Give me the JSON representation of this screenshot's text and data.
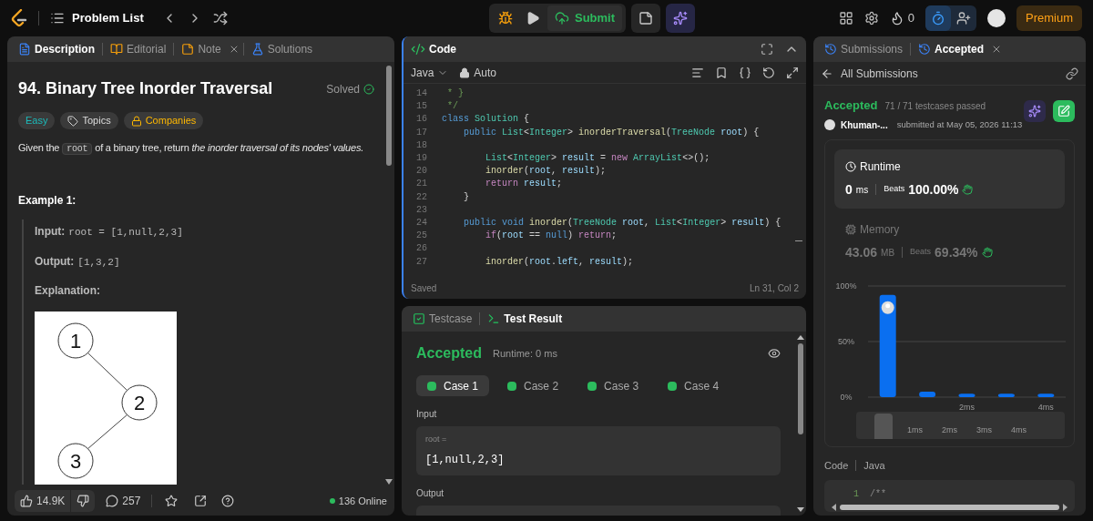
{
  "nav": {
    "problem_list": "Problem List",
    "submit": "Submit",
    "streak": "0",
    "premium": "Premium"
  },
  "description_panel": {
    "tabs": [
      {
        "label": "Description",
        "kind": "description",
        "selected": true,
        "closable": false
      },
      {
        "label": "Editorial",
        "kind": "editorial",
        "selected": false,
        "closable": false
      },
      {
        "label": "Note",
        "kind": "note",
        "selected": false,
        "closable": true
      },
      {
        "label": "Solutions",
        "kind": "solutions",
        "selected": false,
        "closable": false
      }
    ],
    "title": "94. Binary Tree Inorder Traversal",
    "status": "Solved",
    "tags": [
      {
        "label": "Easy",
        "kind": "difficulty"
      },
      {
        "label": "Topics",
        "kind": "topics"
      },
      {
        "label": "Companies",
        "kind": "companies"
      }
    ],
    "statement": [
      {
        "kind": "text",
        "text": "Given the "
      },
      {
        "kind": "code",
        "text": "root"
      },
      {
        "kind": "text",
        "text": " of a binary tree, return *the inorder traversal of its nodes' values.*"
      }
    ],
    "example": {
      "heading": "Example 1:",
      "lines": [
        {
          "label": "Input:",
          "value": "root = [1,null,2,3]"
        },
        {
          "label": "Output:",
          "value": "[1,3,2]"
        },
        {
          "label": "Explanation:"
        }
      ],
      "tree_nodes": [
        "1",
        "2",
        "3"
      ]
    },
    "footer": {
      "likes": "14.9K",
      "comments": "257",
      "online": "136 Online"
    }
  },
  "code_panel": {
    "title": "Code",
    "language": "Java",
    "mode": "Auto",
    "lines": [
      {
        "number": "14",
        "tokens": [
          {
            "kind": "comment",
            "text": " * }"
          }
        ]
      },
      {
        "number": "15",
        "tokens": [
          {
            "kind": "comment",
            "text": " */"
          }
        ]
      },
      {
        "number": "16",
        "tokens": [
          {
            "kind": "keyword",
            "text": "class "
          },
          {
            "kind": "type",
            "text": "Solution"
          },
          {
            "kind": "plain",
            "text": " {"
          }
        ]
      },
      {
        "number": "17",
        "tokens": [
          {
            "kind": "keyword",
            "text": "    public "
          },
          {
            "kind": "type",
            "text": "List"
          },
          {
            "kind": "plain",
            "text": "<"
          },
          {
            "kind": "type",
            "text": "Integer"
          },
          {
            "kind": "plain",
            "text": "> "
          },
          {
            "kind": "function",
            "text": "inorderTraversal"
          },
          {
            "kind": "plain",
            "text": "("
          },
          {
            "kind": "type",
            "text": "TreeNode "
          },
          {
            "kind": "variable",
            "text": "root"
          },
          {
            "kind": "plain",
            "text": ") {"
          }
        ]
      },
      {
        "number": "18"
      },
      {
        "number": "19",
        "tokens": [
          {
            "kind": "type",
            "text": "        List"
          },
          {
            "kind": "plain",
            "text": "<"
          },
          {
            "kind": "type",
            "text": "Integer"
          },
          {
            "kind": "plain",
            "text": "> "
          },
          {
            "kind": "variable",
            "text": "result"
          },
          {
            "kind": "plain",
            "text": " = "
          },
          {
            "kind": "control",
            "text": "new "
          },
          {
            "kind": "type",
            "text": "ArrayList"
          },
          {
            "kind": "plain",
            "text": "<>();"
          }
        ]
      },
      {
        "number": "20",
        "tokens": [
          {
            "kind": "function",
            "text": "        inorder"
          },
          {
            "kind": "plain",
            "text": "("
          },
          {
            "kind": "variable",
            "text": "root"
          },
          {
            "kind": "plain",
            "text": ", "
          },
          {
            "kind": "variable",
            "text": "result"
          },
          {
            "kind": "plain",
            "text": ");"
          }
        ]
      },
      {
        "number": "21",
        "tokens": [
          {
            "kind": "control",
            "text": "        return "
          },
          {
            "kind": "variable",
            "text": "result"
          },
          {
            "kind": "plain",
            "text": ";"
          }
        ]
      },
      {
        "number": "22",
        "tokens": [
          {
            "kind": "plain",
            "text": "    }"
          }
        ]
      },
      {
        "number": "23"
      },
      {
        "number": "24",
        "tokens": [
          {
            "kind": "keyword",
            "text": "    public void "
          },
          {
            "kind": "function",
            "text": "inorder"
          },
          {
            "kind": "plain",
            "text": "("
          },
          {
            "kind": "type",
            "text": "TreeNode "
          },
          {
            "kind": "variable",
            "text": "root"
          },
          {
            "kind": "plain",
            "text": ", "
          },
          {
            "kind": "type",
            "text": "List"
          },
          {
            "kind": "plain",
            "text": "<"
          },
          {
            "kind": "type",
            "text": "Integer"
          },
          {
            "kind": "plain",
            "text": "> "
          },
          {
            "kind": "variable",
            "text": "result"
          },
          {
            "kind": "plain",
            "text": ") {"
          }
        ]
      },
      {
        "number": "25",
        "tokens": [
          {
            "kind": "control",
            "text": "        if"
          },
          {
            "kind": "plain",
            "text": "("
          },
          {
            "kind": "variable",
            "text": "root"
          },
          {
            "kind": "plain",
            "text": " == "
          },
          {
            "kind": "keyword",
            "text": "null"
          },
          {
            "kind": "plain",
            "text": ") "
          },
          {
            "kind": "control",
            "text": "return"
          },
          {
            "kind": "plain",
            "text": ";"
          }
        ]
      },
      {
        "number": "26"
      },
      {
        "number": "27",
        "tokens": [
          {
            "kind": "function",
            "text": "        inorder"
          },
          {
            "kind": "plain",
            "text": "("
          },
          {
            "kind": "variable",
            "text": "root"
          },
          {
            "kind": "plain",
            "text": "."
          },
          {
            "kind": "variable",
            "text": "left"
          },
          {
            "kind": "plain",
            "text": ", "
          },
          {
            "kind": "variable",
            "text": "result"
          },
          {
            "kind": "plain",
            "text": ");"
          }
        ]
      }
    ],
    "status": "Saved",
    "cursor": "Ln 31, Col 2"
  },
  "result_panel": {
    "tabs": [
      {
        "label": "Testcase",
        "kind": "testcase",
        "selected": false
      },
      {
        "label": "Test Result",
        "kind": "result",
        "selected": true
      }
    ],
    "verdict": "Accepted",
    "runtime": "Runtime: 0 ms",
    "cases": [
      {
        "label": "Case 1",
        "selected": true,
        "passed": true
      },
      {
        "label": "Case 2",
        "selected": false,
        "passed": true
      },
      {
        "label": "Case 3",
        "selected": false,
        "passed": true
      },
      {
        "label": "Case 4",
        "selected": false,
        "passed": true
      }
    ],
    "input_label": "Input",
    "input_name": "root =",
    "input_value": "[1,null,2,3]",
    "output_label": "Output"
  },
  "submission_panel": {
    "tabs": [
      {
        "label": "Submissions",
        "selected": false,
        "closable": false
      },
      {
        "label": "Accepted",
        "selected": true,
        "closable": true
      }
    ],
    "back": "All Submissions",
    "verdict": "Accepted",
    "passed": "71 / 71 testcases passed",
    "user": "Khuman-...",
    "submitted": "submitted at May 05, 2026 11:13",
    "metrics": [
      {
        "kind": "runtime",
        "label": "Runtime",
        "value": "0",
        "unit": "ms",
        "beats_label": "Beats",
        "beats": "100.00%",
        "selected": true
      },
      {
        "kind": "memory",
        "label": "Memory",
        "value": "43.06",
        "unit": "MB",
        "beats_label": "Beats",
        "beats": "69.34%",
        "selected": false
      }
    ],
    "chart_data": {
      "type": "bar",
      "x": [
        0,
        1,
        2,
        3,
        4
      ],
      "xlim": [
        -0.5,
        4.5
      ],
      "ylim": [
        0,
        100
      ],
      "yticks": [
        {
          "value": 0,
          "label": "0%"
        },
        {
          "value": 50,
          "label": "50%"
        },
        {
          "value": 100,
          "label": "100%"
        }
      ],
      "xticks": [
        {
          "value": 2,
          "label": "2ms"
        },
        {
          "value": 4,
          "label": "4ms"
        }
      ],
      "series": [
        {
          "color": "#0a6ff0",
          "values": [
            92,
            5,
            3,
            3,
            3
          ]
        }
      ]
    },
    "navigator": [
      "1ms",
      "2ms",
      "3ms",
      "4ms"
    ],
    "code_label": "Code",
    "code_language": "Java",
    "code_preview": {
      "number": "1",
      "text": "/**"
    }
  }
}
